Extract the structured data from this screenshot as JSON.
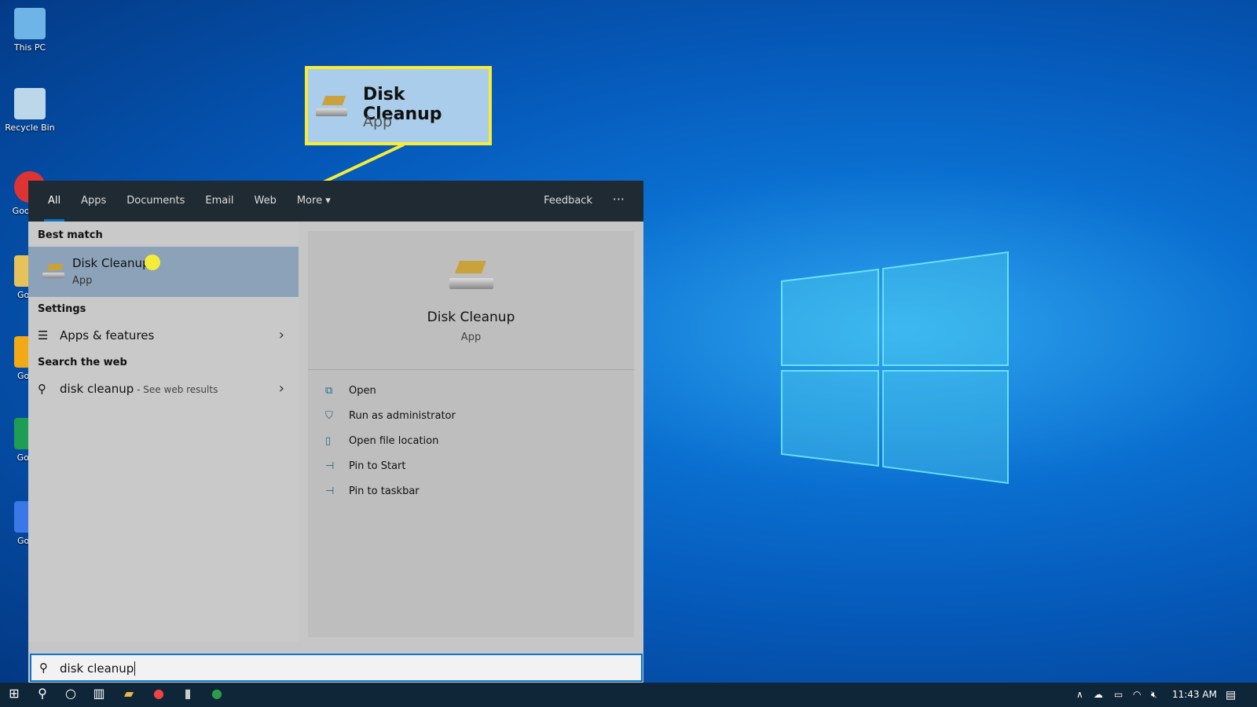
{
  "desktop": {
    "icons": [
      {
        "label": "This PC"
      },
      {
        "label": "Recycle Bin"
      },
      {
        "label": "Goo Chr"
      },
      {
        "label": "Googl"
      },
      {
        "label": "Googl"
      },
      {
        "label": "Go Sh"
      },
      {
        "label": "Googl"
      }
    ]
  },
  "callout": {
    "title": "Disk Cleanup",
    "subtitle": "App",
    "color": "#f5ec3a"
  },
  "search_panel": {
    "tabs": [
      {
        "label": "All",
        "active": true
      },
      {
        "label": "Apps"
      },
      {
        "label": "Documents"
      },
      {
        "label": "Email"
      },
      {
        "label": "Web"
      },
      {
        "label": "More ▾"
      }
    ],
    "feedback": "Feedback",
    "more_options": "···",
    "best_match_header": "Best match",
    "best_match": {
      "title": "Disk Cleanup",
      "subtitle": "App"
    },
    "settings_header": "Settings",
    "settings_item": "Apps & features",
    "web_header": "Search the web",
    "web_item": {
      "query": "disk cleanup",
      "suffix": " - See web results"
    },
    "preview": {
      "title": "Disk Cleanup",
      "subtitle": "App",
      "actions": [
        {
          "label": "Open",
          "icon": "open-icon"
        },
        {
          "label": "Run as administrator",
          "icon": "shield-icon"
        },
        {
          "label": "Open file location",
          "icon": "folder-icon"
        },
        {
          "label": "Pin to Start",
          "icon": "pin-icon"
        },
        {
          "label": "Pin to taskbar",
          "icon": "pin-icon"
        }
      ]
    }
  },
  "search_box": {
    "value": "disk cleanup"
  },
  "taskbar": {
    "time": "11:43 AM"
  }
}
